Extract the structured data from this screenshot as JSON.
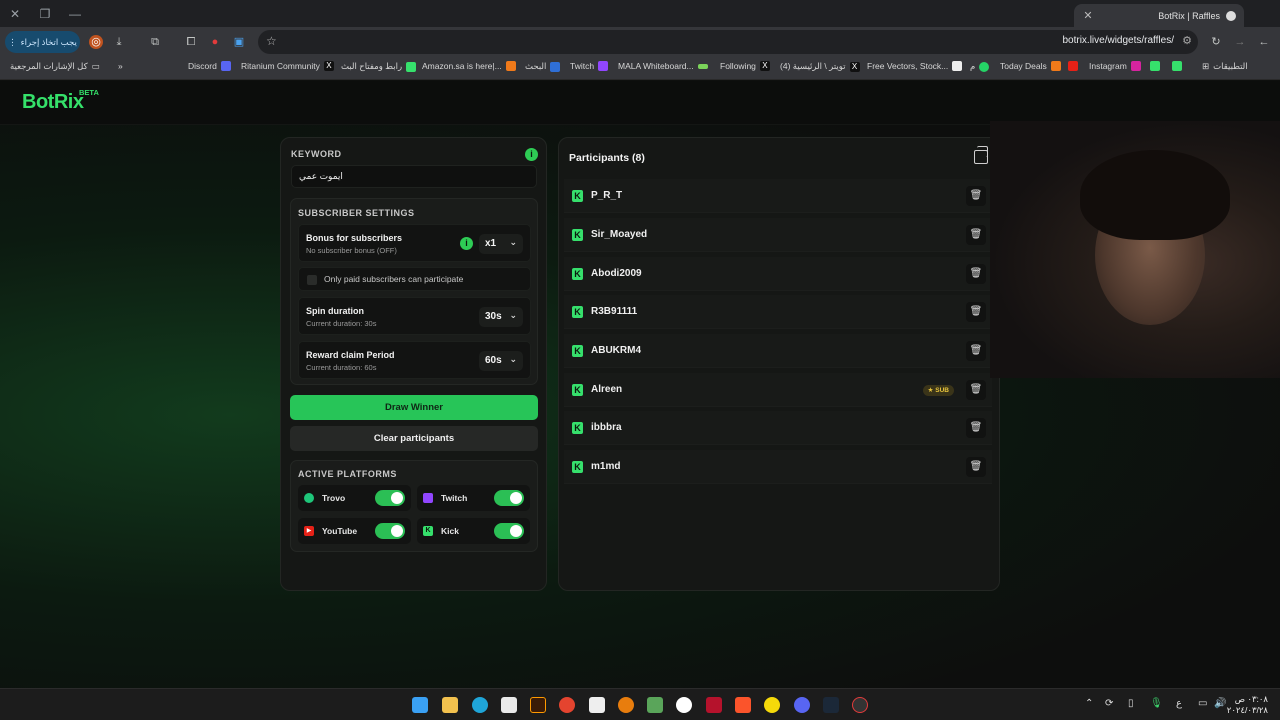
{
  "browser": {
    "tab_title": "BotRix | Raffles",
    "url": "botrix.live/widgets/raffles/",
    "ext_pill": "يجب اتخاذ إجراء",
    "bookmarks_all": "كل الإشارات المرجعية",
    "bookmarks_apps": "التطبيقات",
    "bookmarks": [
      {
        "label": "Discord"
      },
      {
        "label": "Ritanium Community"
      },
      {
        "label": "رابط ومفتاح البث"
      },
      {
        "label": "Amazon.sa is here|..."
      },
      {
        "label": "البحث"
      },
      {
        "label": "Twitch"
      },
      {
        "label": "MALA Whiteboard..."
      },
      {
        "label": "Following"
      },
      {
        "label": "تويتر \\ الرئيسية (4)"
      },
      {
        "label": "Free Vectors, Stock..."
      },
      {
        "label": "م"
      },
      {
        "label": "Today Deals"
      },
      {
        "label": "Instagram"
      }
    ]
  },
  "site": {
    "logo": "BotRix",
    "beta": "BETA"
  },
  "raffle": {
    "keyword_label": "KEYWORD",
    "keyword_value": "ايموت عمي",
    "subscriber_settings_label": "SUBSCRIBER SETTINGS",
    "bonus": {
      "title": "Bonus for subscribers",
      "sub": "No subscriber bonus (OFF)",
      "value": "x1"
    },
    "only_paid_label": "Only paid subscribers can participate",
    "spin": {
      "title": "Spin duration",
      "sub": "Current duration: 30s",
      "value": "30s"
    },
    "reward": {
      "title": "Reward claim Period",
      "sub": "Current duration: 60s",
      "value": "60s"
    },
    "draw_button": "Draw Winner",
    "clear_button": "Clear participants",
    "platforms_label": "ACTIVE PLATFORMS",
    "platforms": [
      {
        "name": "Trovo",
        "enabled": true
      },
      {
        "name": "Twitch",
        "enabled": true
      },
      {
        "name": "YouTube",
        "enabled": true
      },
      {
        "name": "Kick",
        "enabled": true
      }
    ]
  },
  "participants": {
    "title": "Participants (8)",
    "sub_badge": "SUB",
    "list": [
      {
        "name": "P_R_T"
      },
      {
        "name": "Sir_Moayed"
      },
      {
        "name": "Abodi2009"
      },
      {
        "name": "R3B91111"
      },
      {
        "name": "ABUKRM4"
      },
      {
        "name": "Alreen"
      },
      {
        "name": "ibbbra"
      },
      {
        "name": "m1md"
      }
    ]
  },
  "taskbar": {
    "lang": "ع",
    "time": "٠٣:٠٨ ص",
    "date": "٢٠٢٤/٠٣/٢٨"
  },
  "colors": {
    "accent": "#27c558",
    "panel": "#151715",
    "background": "#0e0f0e"
  }
}
